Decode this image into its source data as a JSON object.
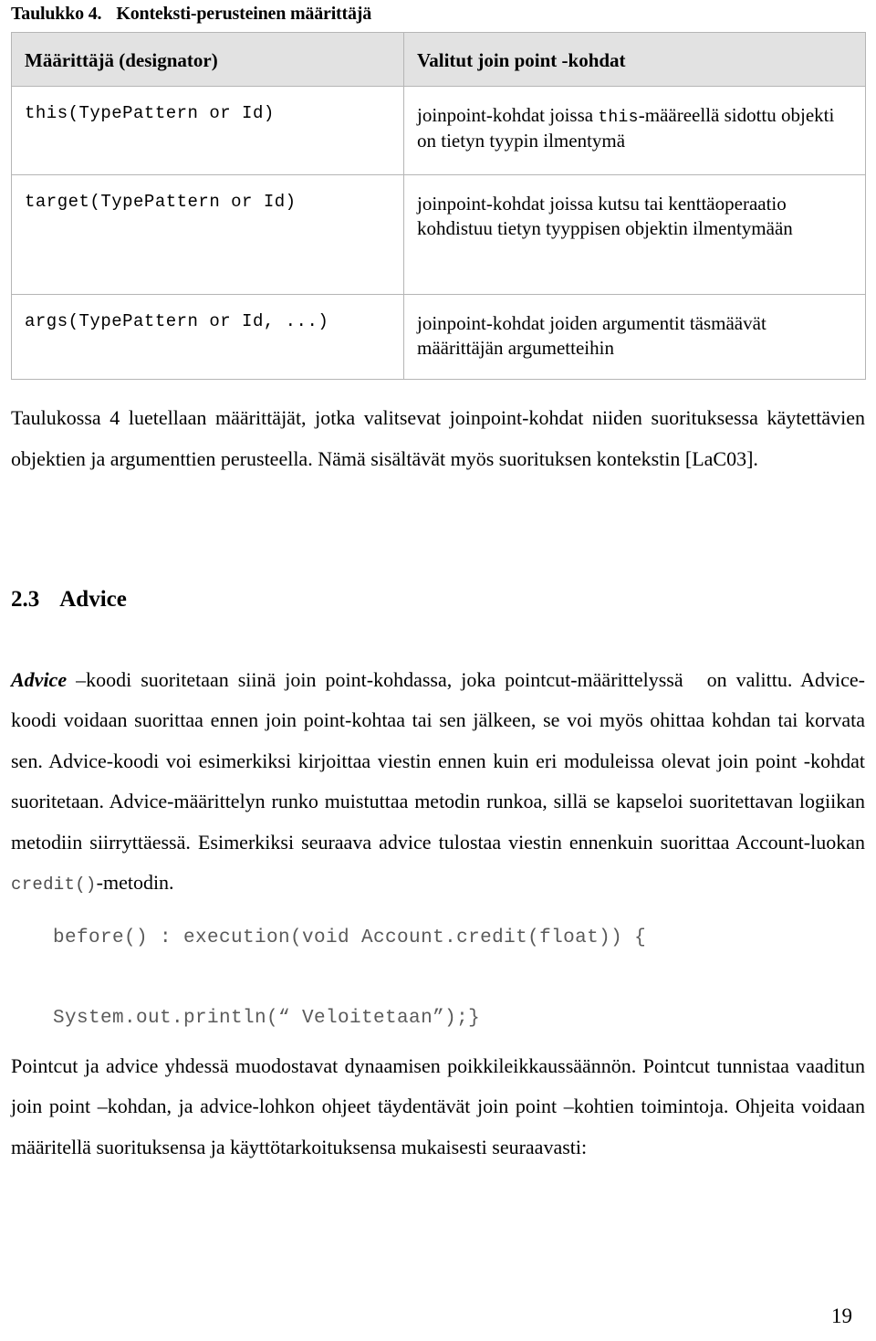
{
  "document": {
    "page_number": "19"
  },
  "table_caption": {
    "number": "Taulukko 4.",
    "title": "Konteksti-perusteinen määrittäjä"
  },
  "table": {
    "headers": {
      "col1": "Määrittäjä (designator)",
      "col2": "Valitut join point -kohdat"
    },
    "rows": [
      {
        "designator": "this(TypePattern or Id)",
        "description_pre": "joinpoint-kohdat joissa ",
        "description_mono": "this",
        "description_post": "-määreellä sidottu objekti on tietyn tyypin ilmentymä"
      },
      {
        "designator": "target(TypePattern or Id)",
        "description_pre": "joinpoint-kohdat joissa kutsu tai kenttäoperaatio kohdistuu tietyn tyyppisen objektin ilmentymään",
        "description_mono": "",
        "description_post": ""
      },
      {
        "designator": "args(TypePattern or Id, ...)",
        "description_pre": "joinpoint-kohdat joiden argumentit täsmäävät määrittäjän argumetteihin",
        "description_mono": "",
        "description_post": ""
      }
    ]
  },
  "paragraph_after_table": "Taulukossa 4 luetellaan määrittäjät, jotka valitsevat joinpoint-kohdat niiden suorituksessa käytettävien objektien ja argumenttien perusteella. Nämä sisältävät myös suorituksen kontekstin [LaC03].",
  "section": {
    "number": "2.3",
    "title": "Advice"
  },
  "advice_paragraph": {
    "lead": "Advice",
    "part1": " –koodi suoritetaan siinä join point-kohdassa, joka pointcut-määrittelyssä",
    "part2": "on valittu. Advice-koodi voidaan suorittaa ennen join point-kohtaa tai sen jälkeen, se voi myös ohittaa kohdan tai korvata sen. Advice-koodi voi esimerkiksi kirjoittaa viestin ennen kuin eri moduleissa olevat join point -kohdat suoritetaan. Advice-määrittelyn runko muistuttaa metodin runkoa, sillä se kapseloi suoritettavan logiikan metodiin siirryttäessä. Esimerkiksi seuraava advice tulostaa viestin ennenkuin suorittaa Account-luokan ",
    "code_inline": "credit()",
    "part3": "-metodin."
  },
  "code_block": {
    "line1": "before() : execution(void Account.credit(float)) {",
    "line2": "System.out.println(“ Veloitetaan”);}"
  },
  "final_paragraph": "Pointcut ja advice yhdessä muodostavat dynaamisen poikkileikkaussäännön. Pointcut tunnistaa vaaditun join point –kohdan, ja advice-lohkon ohjeet täydentävät join point –kohtien toimintoja. Ohjeita voidaan määritellä suorituksensa ja käyttötarkoituksensa mukaisesti seuraavasti:"
}
